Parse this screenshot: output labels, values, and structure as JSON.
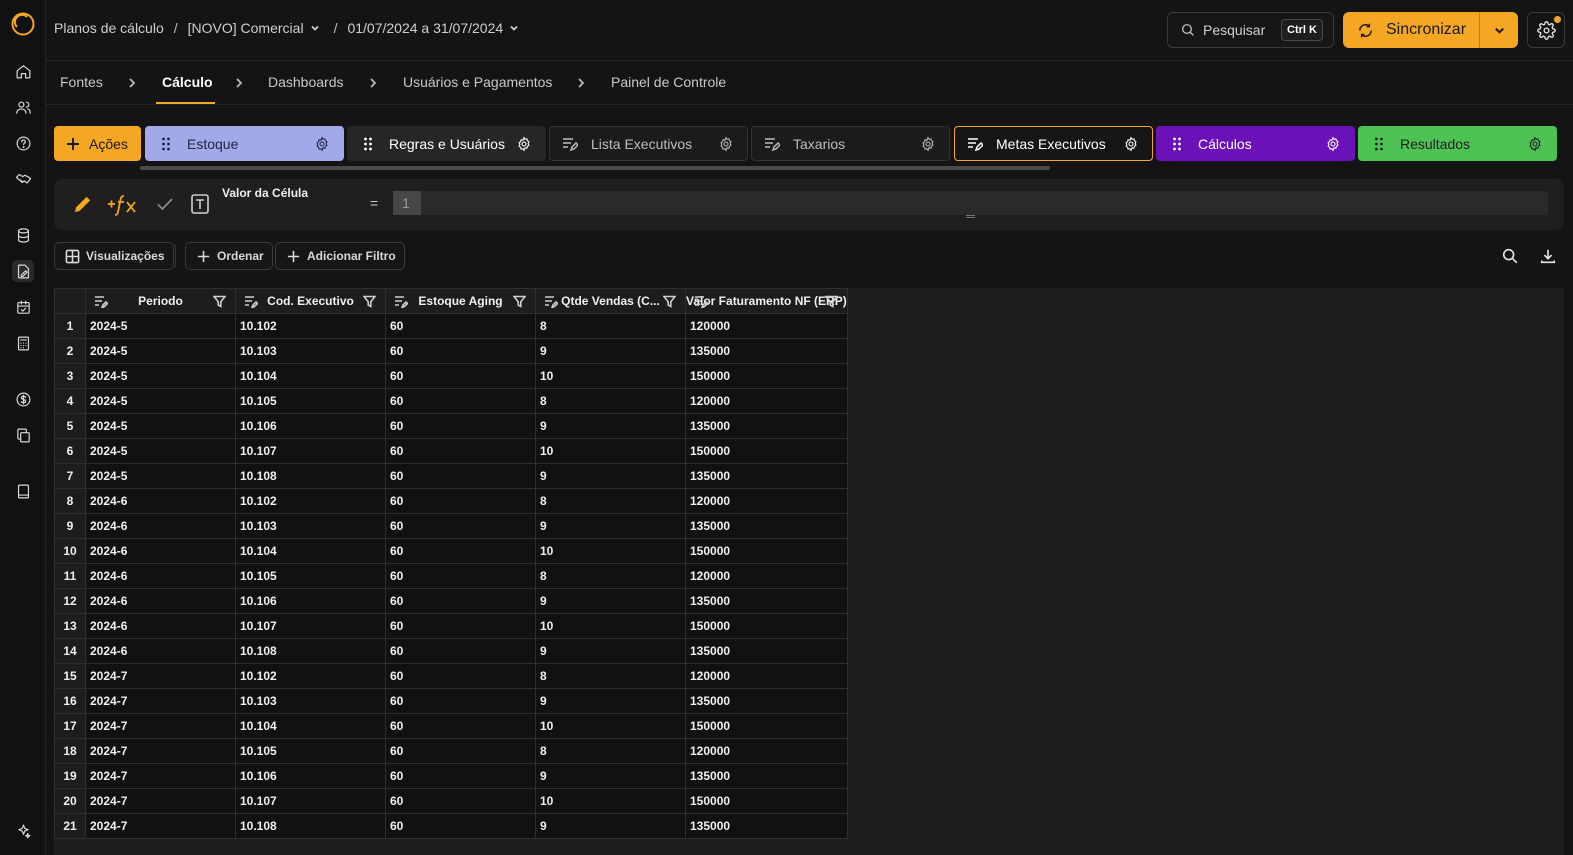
{
  "breadcrumb": {
    "root": "Planos de cálculo",
    "plan": "[NOVO] Comercial",
    "period": "01/07/2024 a 31/07/2024"
  },
  "search": {
    "label": "Pesquisar",
    "shortcut": "Ctrl K"
  },
  "sync": {
    "label": "Sincronizar"
  },
  "steps": [
    "Fontes",
    "Cálculo",
    "Dashboards",
    "Usuários e Pagamentos",
    "Painel de Controle"
  ],
  "actions_label": "Ações",
  "tabs": [
    {
      "label": "Estoque",
      "bg": "#a2a9e8",
      "fg": "#1f2540"
    },
    {
      "label": "Regras e Usuários",
      "bg": "#262626",
      "fg": "#ffffff"
    },
    {
      "label": "Lista Executivos",
      "bg": "#1b1b1b",
      "fg": "#bdbdbd"
    },
    {
      "label": "Taxarios",
      "bg": "#1b1b1b",
      "fg": "#bdbdbd"
    },
    {
      "label": "Metas Executivos",
      "bg": "#161616",
      "fg": "#ffffff",
      "border": "#f5a623"
    },
    {
      "label": "Cálculos",
      "bg": "#6a12b8",
      "fg": "#ffffff"
    },
    {
      "label": "Resultados",
      "bg": "#4ec254",
      "fg": "#1f1f1f"
    }
  ],
  "formula": {
    "cell_label": "Valor da Célula",
    "equals": "=",
    "value": "1"
  },
  "toolbar": {
    "views": "Visualizações",
    "sort": "Ordenar",
    "filter": "Adicionar Filtro"
  },
  "table": {
    "columns": [
      "Periodo",
      "Cod. Executivo",
      "Estoque Aging",
      "Qtde Vendas (C...",
      "Valor Faturamento NF (ERP)"
    ],
    "rows": [
      [
        "1",
        "2024-5",
        "10.102",
        "60",
        "8",
        "120000"
      ],
      [
        "2",
        "2024-5",
        "10.103",
        "60",
        "9",
        "135000"
      ],
      [
        "3",
        "2024-5",
        "10.104",
        "60",
        "10",
        "150000"
      ],
      [
        "4",
        "2024-5",
        "10.105",
        "60",
        "8",
        "120000"
      ],
      [
        "5",
        "2024-5",
        "10.106",
        "60",
        "9",
        "135000"
      ],
      [
        "6",
        "2024-5",
        "10.107",
        "60",
        "10",
        "150000"
      ],
      [
        "7",
        "2024-5",
        "10.108",
        "60",
        "9",
        "135000"
      ],
      [
        "8",
        "2024-6",
        "10.102",
        "60",
        "8",
        "120000"
      ],
      [
        "9",
        "2024-6",
        "10.103",
        "60",
        "9",
        "135000"
      ],
      [
        "10",
        "2024-6",
        "10.104",
        "60",
        "10",
        "150000"
      ],
      [
        "11",
        "2024-6",
        "10.105",
        "60",
        "8",
        "120000"
      ],
      [
        "12",
        "2024-6",
        "10.106",
        "60",
        "9",
        "135000"
      ],
      [
        "13",
        "2024-6",
        "10.107",
        "60",
        "10",
        "150000"
      ],
      [
        "14",
        "2024-6",
        "10.108",
        "60",
        "9",
        "135000"
      ],
      [
        "15",
        "2024-7",
        "10.102",
        "60",
        "8",
        "120000"
      ],
      [
        "16",
        "2024-7",
        "10.103",
        "60",
        "9",
        "135000"
      ],
      [
        "17",
        "2024-7",
        "10.104",
        "60",
        "10",
        "150000"
      ],
      [
        "18",
        "2024-7",
        "10.105",
        "60",
        "8",
        "120000"
      ],
      [
        "19",
        "2024-7",
        "10.106",
        "60",
        "9",
        "135000"
      ],
      [
        "20",
        "2024-7",
        "10.107",
        "60",
        "10",
        "150000"
      ],
      [
        "21",
        "2024-7",
        "10.108",
        "60",
        "9",
        "135000"
      ]
    ]
  }
}
